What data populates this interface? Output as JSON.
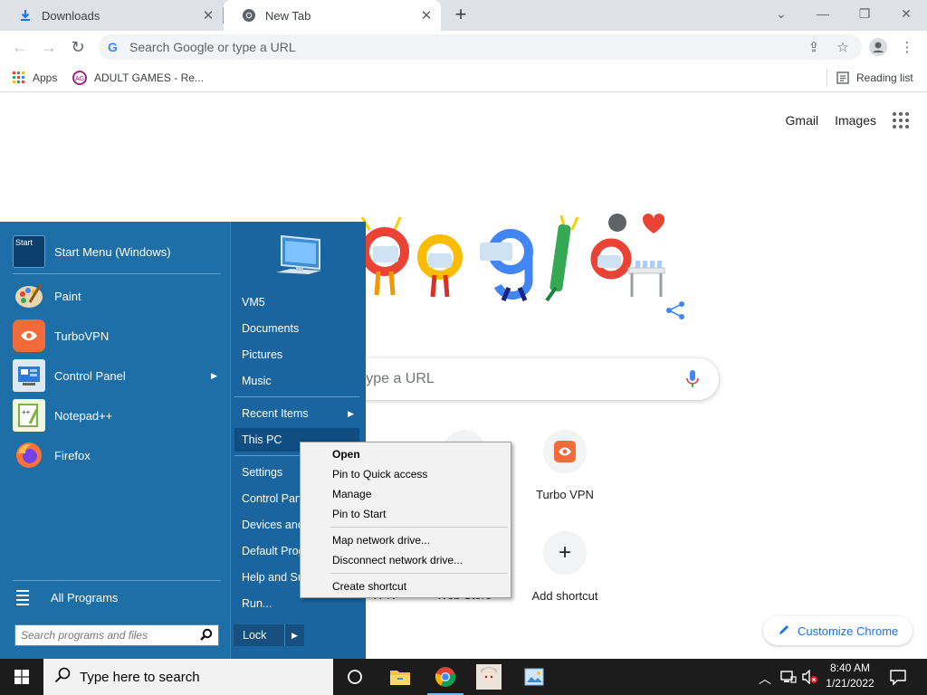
{
  "browser": {
    "tabs": [
      {
        "label": "Downloads",
        "icon": "download-icon"
      },
      {
        "label": "New Tab",
        "icon": "chrome-icon"
      }
    ],
    "omnibox_placeholder": "Search Google or type a URL",
    "bookmarks": {
      "apps_label": "Apps",
      "item1_label": "ADULT GAMES - Re...",
      "reading_list_label": "Reading list"
    }
  },
  "ntp": {
    "top_links": {
      "gmail": "Gmail",
      "images": "Images"
    },
    "search_placeholder": "r type a URL",
    "shortcuts": [
      {
        "label": "Turbo VPN",
        "icon": "turbovpn-icon"
      },
      {
        "label": "Add shortcut",
        "icon": "plus-icon"
      }
    ],
    "partial_labels": {
      "vpn": "VPN",
      "webstore": "Web Store"
    },
    "customize_label": "Customize Chrome"
  },
  "start_menu": {
    "pinned": [
      {
        "label": "Start Menu (Windows)",
        "icon": "start-menu-icon"
      },
      {
        "label": "Paint",
        "icon": "paint-icon"
      },
      {
        "label": "TurboVPN",
        "icon": "turbovpn-icon"
      },
      {
        "label": "Control Panel",
        "icon": "control-panel-icon",
        "has_submenu": true
      },
      {
        "label": "Notepad++",
        "icon": "notepadpp-icon"
      },
      {
        "label": "Firefox",
        "icon": "firefox-icon"
      }
    ],
    "all_programs_label": "All Programs",
    "search_placeholder": "Search programs and files",
    "right_panel": {
      "user": "VM5",
      "documents": "Documents",
      "pictures": "Pictures",
      "music": "Music",
      "recent_items": "Recent Items",
      "this_pc": "This PC",
      "settings": "Settings",
      "control_panel": "Control Panel",
      "devices": "Devices and Printers",
      "default_programs": "Default Programs",
      "help": "Help and Support",
      "run": "Run..."
    },
    "lock_label": "Lock"
  },
  "context_menu": {
    "items": [
      "Open",
      "Pin to Quick access",
      "Manage",
      "Pin to Start",
      "Map network drive...",
      "Disconnect network drive...",
      "Create shortcut"
    ]
  },
  "taskbar": {
    "search_placeholder": "Type here to search",
    "time": "8:40 AM",
    "date": "1/21/2022"
  },
  "colors": {
    "start_menu_bg": "#1e6ea8",
    "taskbar_bg": "#1c1c1c",
    "chrome_accent": "#1a73e8"
  }
}
